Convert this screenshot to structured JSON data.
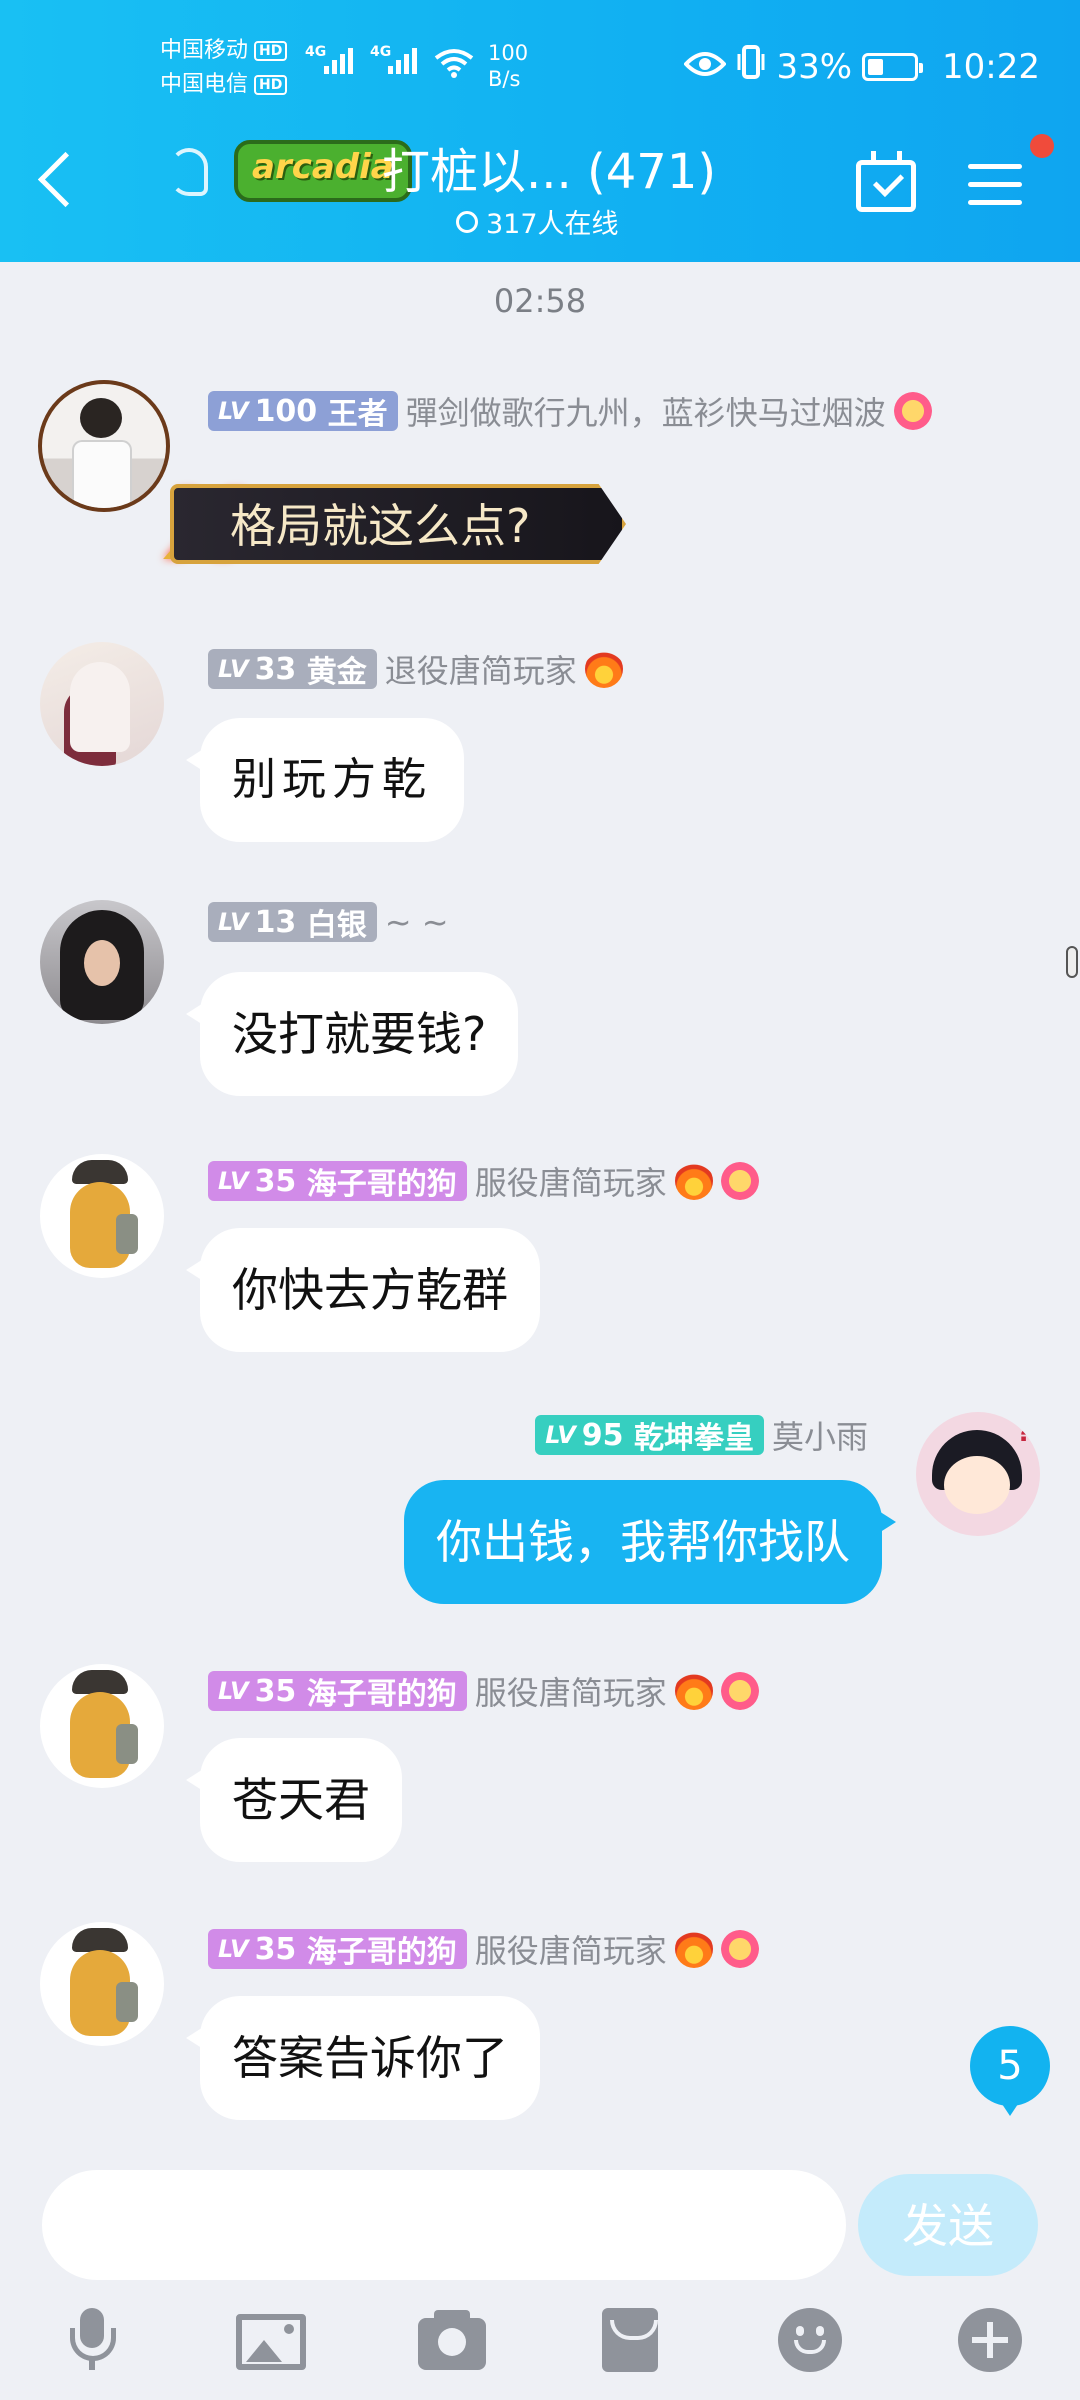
{
  "status_bar": {
    "carrier1": "中国移动",
    "carrier2": "中国电信",
    "hd": "HD",
    "net": "4G",
    "speed_value": "100",
    "speed_unit": "B/s",
    "battery": "33%",
    "time": "10:22"
  },
  "header": {
    "logo_text": "arcadia",
    "title": "打桩以... (471)",
    "online": "317人在线"
  },
  "chat": {
    "time_divider": "02:58",
    "messages": [
      {
        "level": "100",
        "rank": "王者",
        "nick": "彈剑做歌行九州，蓝衫快马过烟波",
        "text": "格局就这么点?"
      },
      {
        "level": "33",
        "rank": "黄金",
        "nick": "退役唐简玩家",
        "text": "别玩方乾"
      },
      {
        "level": "13",
        "rank": "白银",
        "nick": "~ ~",
        "text": "没打就要钱?"
      },
      {
        "level": "35",
        "rank": "海子哥的狗",
        "nick": "服役唐简玩家",
        "text": "你快去方乾群"
      },
      {
        "level": "95",
        "rank": "乾坤拳皇",
        "nick": "莫小雨",
        "text": "你出钱，我帮你找队"
      },
      {
        "level": "35",
        "rank": "海子哥的狗",
        "nick": "服役唐简玩家",
        "text": "苍天君"
      },
      {
        "level": "35",
        "rank": "海子哥的狗",
        "nick": "服役唐简玩家",
        "text": "答案告诉你了"
      }
    ],
    "lv_prefix": "LV",
    "unread_count": "5"
  },
  "input": {
    "placeholder": "",
    "send_label": "发送"
  },
  "colors": {
    "header": "#11b0f2",
    "my_bubble": "#18b4f2",
    "send_disabled": "#c4ebfb"
  }
}
